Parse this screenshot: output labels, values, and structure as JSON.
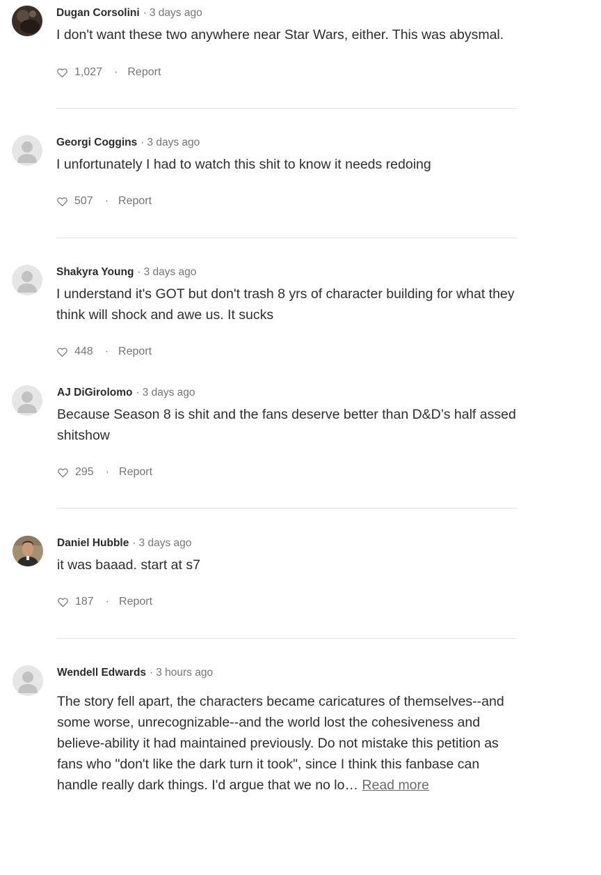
{
  "comments": [
    {
      "author": "Dugan Corsolini",
      "time": "3 days ago",
      "text": "I don't want these two anywhere near Star Wars, either. This was abysmal.",
      "likes": "1,027",
      "report": "Report",
      "avatar": "photo-dark"
    },
    {
      "author": "Georgi Coggins",
      "time": "3 days ago",
      "text": "I unfortunately I had to watch this shit to know it needs redoing",
      "likes": "507",
      "report": "Report",
      "avatar": "default"
    },
    {
      "author": "Shakyra Young",
      "time": "3 days ago",
      "text": "I understand it's GOT but don't trash 8 yrs of character building for what they think will shock and awe us. It sucks",
      "likes": "448",
      "report": "Report",
      "avatar": "default"
    },
    {
      "author": "AJ DiGirolomo",
      "time": "3 days ago",
      "text": "Because Season 8 is shit and the fans deserve better than D&D’s half assed shitshow",
      "likes": "295",
      "report": "Report",
      "avatar": "default"
    },
    {
      "author": "Daniel Hubble",
      "time": "3 days ago",
      "text": "it was baaad. start at s7",
      "likes": "187",
      "report": "Report",
      "avatar": "photo-person"
    },
    {
      "author": "Wendell Edwards",
      "time": "3 hours ago",
      "text": "The story fell apart, the characters became caricatures of themselves--and some worse, unrecognizable--and the world lost the cohesiveness and believe-ability it had maintained previously. Do not mistake this petition as fans who \"don't like the dark turn it took\", since I think this fanbase can handle really dark things. I'd argue that we no lo…",
      "read_more": "Read more",
      "avatar": "default"
    }
  ],
  "colors": {
    "author": "#2b2b2b",
    "meta": "#757575",
    "divider": "#e3e3e3",
    "default_avatar_bg": "#e6e6e6",
    "default_avatar_fg": "#c2c2c2"
  }
}
